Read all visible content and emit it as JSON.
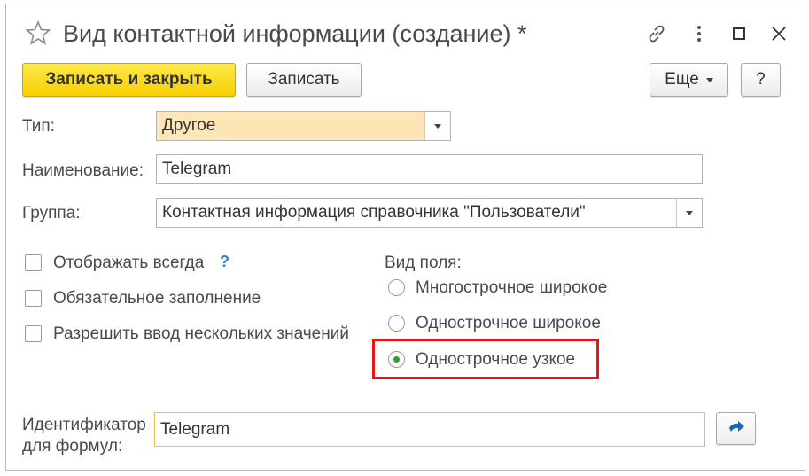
{
  "window": {
    "title": "Вид контактной информации (создание) *",
    "icons": [
      "star-icon",
      "link-icon",
      "more-icon",
      "maximize-icon",
      "close-icon"
    ]
  },
  "toolbar": {
    "save_close_label": "Записать и закрыть",
    "save_label": "Записать",
    "more_label": "Еще",
    "help_label": "?"
  },
  "form": {
    "type_label": "Тип:",
    "type_value": "Другое",
    "name_label": "Наименование:",
    "name_value": "Telegram",
    "group_label": "Группа:",
    "group_value": "Контактная информация справочника \"Пользователи\"",
    "show_always_label": "Отображать всегда",
    "help_mark": "?",
    "required_label": "Обязательное заполнение",
    "multiple_label": "Разрешить ввод нескольких значений",
    "field_kind_label": "Вид поля:",
    "field_kind_options": [
      "Многострочное широкое",
      "Однострочное широкое",
      "Однострочное узкое"
    ],
    "field_kind_selected": "Однострочное узкое",
    "identifier_label_line1": "Идентификатор",
    "identifier_label_line2": "для формул:",
    "identifier_value": "Telegram"
  },
  "colors": {
    "primary_button": "#f5d000",
    "type_field_bg": "#fde5b5",
    "identifier_border": "#e6c24a",
    "highlight": "#e3161b",
    "radio_dot": "#2e9a3e",
    "help_mark": "#2a86c8"
  }
}
